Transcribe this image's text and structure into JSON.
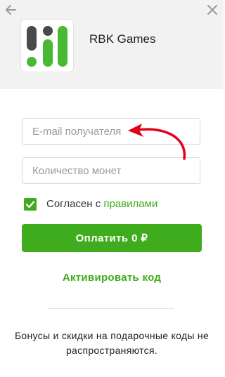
{
  "header": {
    "merchant_name": "RBK Games",
    "icons": {
      "back": "arrow-left-icon",
      "close": "close-x-icon",
      "logo": "rbk-games-logo"
    }
  },
  "form": {
    "email": {
      "placeholder": "E-mail получателя",
      "value": ""
    },
    "coins": {
      "placeholder": "Количество монет",
      "value": ""
    },
    "agree": {
      "checked": true,
      "text": "Согласен с ",
      "link": "правилами"
    },
    "pay_button": "Оплатить 0 ₽",
    "activate_link": "Активировать код"
  },
  "note": "Бонусы и скидки на подарочные коды не распространяются.",
  "colors": {
    "accent": "#3fac1d",
    "header_bg": "#f2f2f2",
    "arrow": "#e3001b"
  }
}
